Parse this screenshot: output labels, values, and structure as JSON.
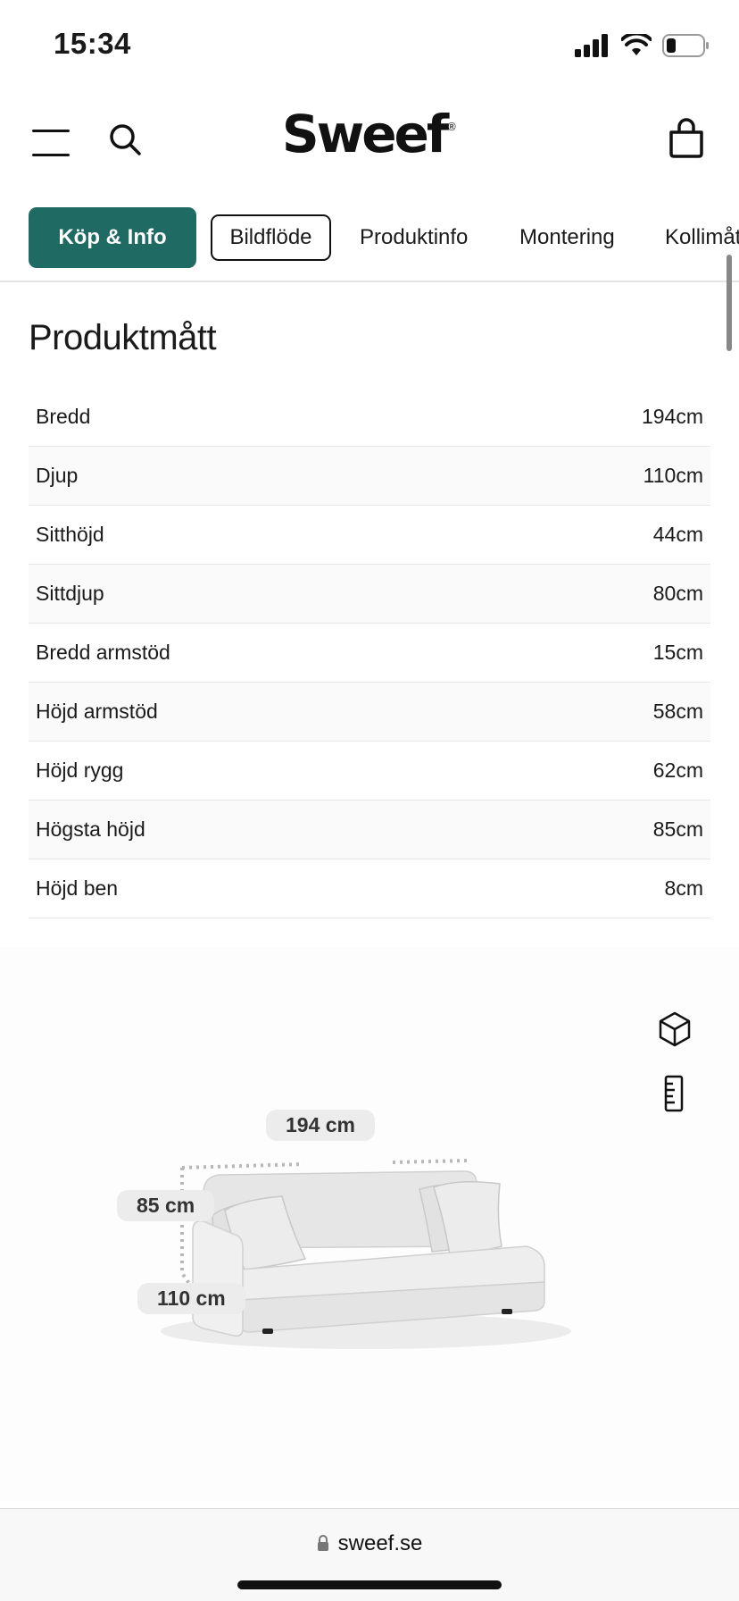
{
  "status_bar": {
    "time": "15:34"
  },
  "header": {
    "logo": "Sweef",
    "logo_mark": "®"
  },
  "tabs": [
    {
      "label": "Köp & Info"
    },
    {
      "label": "Bildflöde"
    },
    {
      "label": "Produktinfo"
    },
    {
      "label": "Montering"
    },
    {
      "label": "Kollimått"
    }
  ],
  "section": {
    "title": "Produktmått"
  },
  "specs": [
    {
      "label": "Bredd",
      "value": "194cm"
    },
    {
      "label": "Djup",
      "value": "110cm"
    },
    {
      "label": "Sitthöjd",
      "value": "44cm"
    },
    {
      "label": "Sittdjup",
      "value": "80cm"
    },
    {
      "label": "Bredd armstöd",
      "value": "15cm"
    },
    {
      "label": "Höjd armstöd",
      "value": "58cm"
    },
    {
      "label": "Höjd rygg",
      "value": "62cm"
    },
    {
      "label": "Högsta höjd",
      "value": "85cm"
    },
    {
      "label": "Höjd ben",
      "value": "8cm"
    }
  ],
  "viewer": {
    "width_label": "194 cm",
    "height_label": "85 cm",
    "depth_label": "110 cm",
    "icons": [
      "cube-icon",
      "ruler-icon"
    ]
  },
  "browser": {
    "url": "sweef.se"
  },
  "colors": {
    "accent": "#1f6b63",
    "text": "#1a1a1a",
    "row_alt": "#fafafa"
  }
}
